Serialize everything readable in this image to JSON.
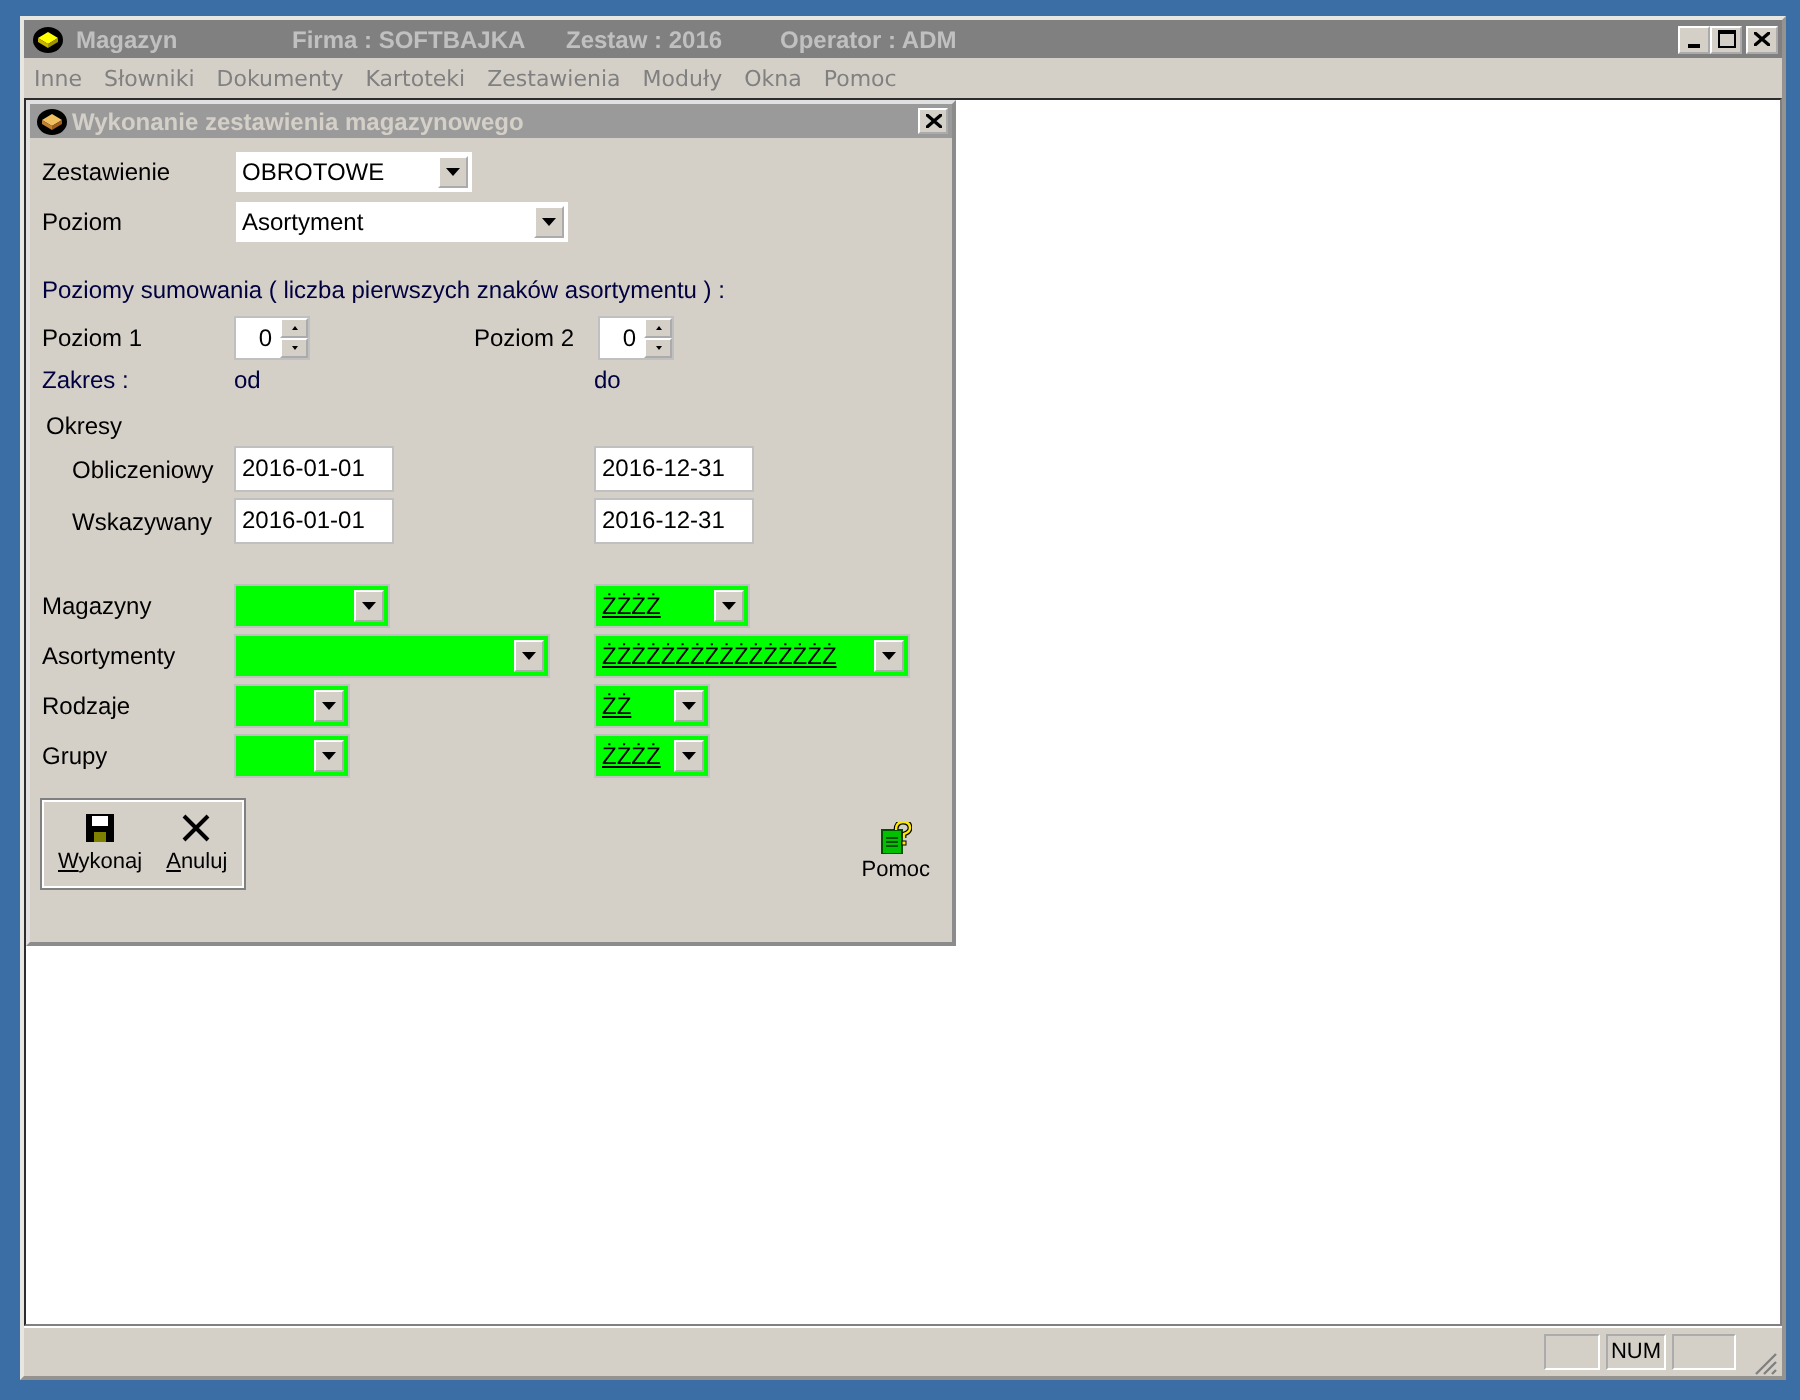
{
  "window": {
    "title": "Magazyn",
    "firma": "Firma : SOFTBAJKA",
    "zestaw": "Zestaw : 2016",
    "operator": "Operator : ADM"
  },
  "menu": [
    "Inne",
    "Słowniki",
    "Dokumenty",
    "Kartoteki",
    "Zestawienia",
    "Moduły",
    "Okna",
    "Pomoc"
  ],
  "dialog": {
    "title": "Wykonanie zestawienia magazynowego",
    "combos": [
      {
        "label": "Zestawienie",
        "value": "OBROTOWE"
      },
      {
        "label": "Poziom",
        "value": "Asortyment"
      }
    ],
    "sum_heading": "Poziomy sumowania ( liczba pierwszych znaków asortymentu ) :",
    "spinners": [
      {
        "label": "Poziom 1",
        "value": "0"
      },
      {
        "label": "Poziom 2",
        "value": "0"
      }
    ],
    "zakres": {
      "label": "Zakres :",
      "od": "od",
      "do": "do"
    },
    "okresy": "Okresy",
    "periods": [
      {
        "label": "Obliczeniowy",
        "from": "2016-01-01",
        "to": "2016-12-31"
      },
      {
        "label": "Wskazywany",
        "from": "2016-01-01",
        "to": "2016-12-31"
      }
    ],
    "filters": [
      {
        "label": "Magazyny",
        "to": "ŻŻŻŻ"
      },
      {
        "label": "Asortymenty",
        "to": "ŻŻŻŻŻŻŻŻŻŻŻŻŻŻŻŻ"
      },
      {
        "label": "Rodzaje",
        "to": "ŻŻ"
      },
      {
        "label": "Grupy",
        "to": "ŻŻŻŻ"
      }
    ],
    "buttons": [
      {
        "label": "Wykonaj",
        "kind": "save",
        "underline_first": true
      },
      {
        "label": "Anuluj",
        "kind": "cancel",
        "underline_first": true
      }
    ],
    "help": "Pomoc"
  },
  "status_bar": {
    "num": "NUM"
  }
}
